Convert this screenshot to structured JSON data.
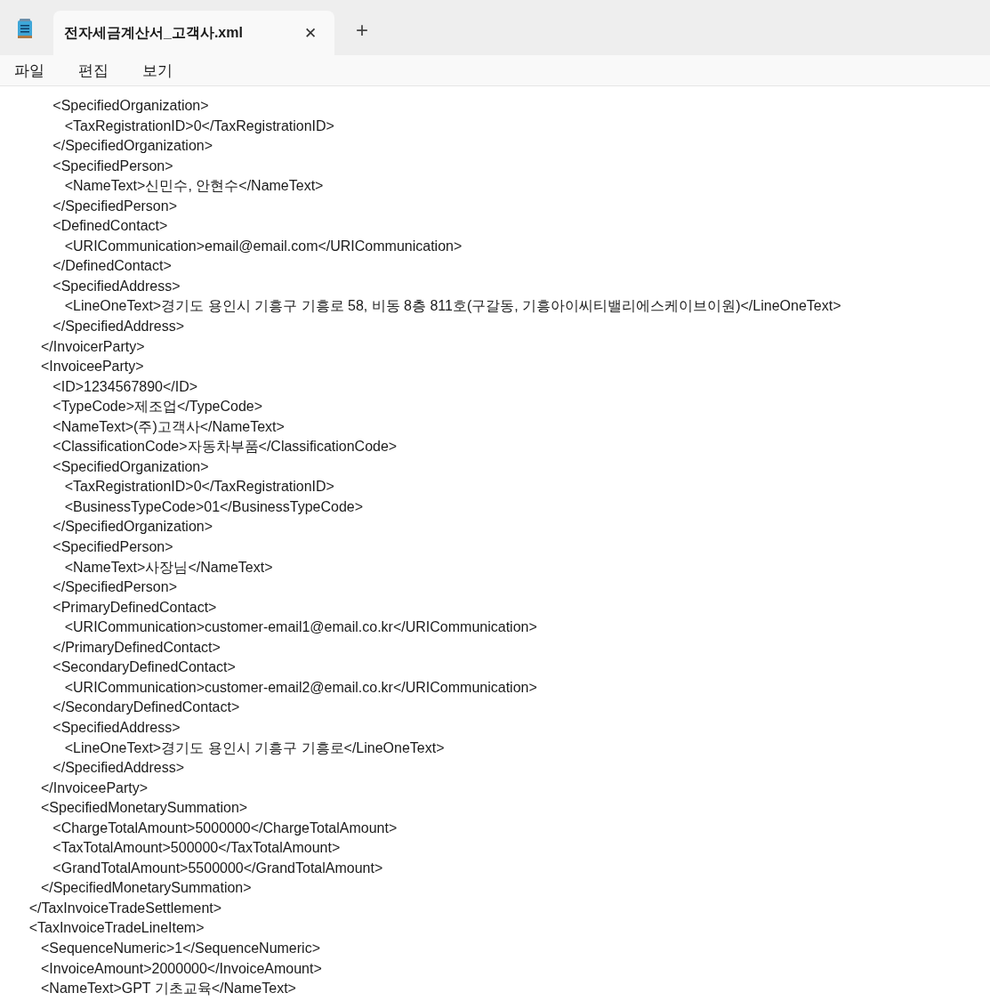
{
  "window": {
    "tabs": [
      {
        "title": "전자세금계산서_고객사.xml",
        "selected": true,
        "close": "✕"
      }
    ],
    "new_tab": "+"
  },
  "menu": [
    "파일",
    "편집",
    "보기"
  ],
  "editor": {
    "lines": [
      "            <SpecifiedOrganization>",
      "               <TaxRegistrationID>0</TaxRegistrationID>",
      "            </SpecifiedOrganization>",
      "            <SpecifiedPerson>",
      "               <NameText>신민수, 안현수</NameText>",
      "            </SpecifiedPerson>",
      "            <DefinedContact>",
      "               <URICommunication>email@email.com</URICommunication>",
      "            </DefinedContact>",
      "            <SpecifiedAddress>",
      "               <LineOneText>경기도 용인시 기흥구 기흥로 58, 비동 8층 811호(구갈동, 기흥아이씨티밸리에스케이브이원)</LineOneText>",
      "            </SpecifiedAddress>",
      "         </InvoicerParty>",
      "         <InvoiceeParty>",
      "            <ID>1234567890</ID>",
      "            <TypeCode>제조업</TypeCode>",
      "            <NameText>(주)고객사</NameText>",
      "            <ClassificationCode>자동차부품</ClassificationCode>",
      "            <SpecifiedOrganization>",
      "               <TaxRegistrationID>0</TaxRegistrationID>",
      "               <BusinessTypeCode>01</BusinessTypeCode>",
      "            </SpecifiedOrganization>",
      "            <SpecifiedPerson>",
      "               <NameText>사장님</NameText>",
      "            </SpecifiedPerson>",
      "            <PrimaryDefinedContact>",
      "               <URICommunication>customer-email1@email.co.kr</URICommunication>",
      "            </PrimaryDefinedContact>",
      "            <SecondaryDefinedContact>",
      "               <URICommunication>customer-email2@email.co.kr</URICommunication>",
      "            </SecondaryDefinedContact>",
      "            <SpecifiedAddress>",
      "               <LineOneText>경기도 용인시 기흥구 기흥로</LineOneText>",
      "            </SpecifiedAddress>",
      "         </InvoiceeParty>",
      "         <SpecifiedMonetarySummation>",
      "            <ChargeTotalAmount>5000000</ChargeTotalAmount>",
      "            <TaxTotalAmount>500000</TaxTotalAmount>",
      "            <GrandTotalAmount>5500000</GrandTotalAmount>",
      "         </SpecifiedMonetarySummation>",
      "      </TaxInvoiceTradeSettlement>",
      "      <TaxInvoiceTradeLineItem>",
      "         <SequenceNumeric>1</SequenceNumeric>",
      "         <InvoiceAmount>2000000</InvoiceAmount>",
      "         <NameText>GPT 기초교육</NameText>"
    ]
  }
}
